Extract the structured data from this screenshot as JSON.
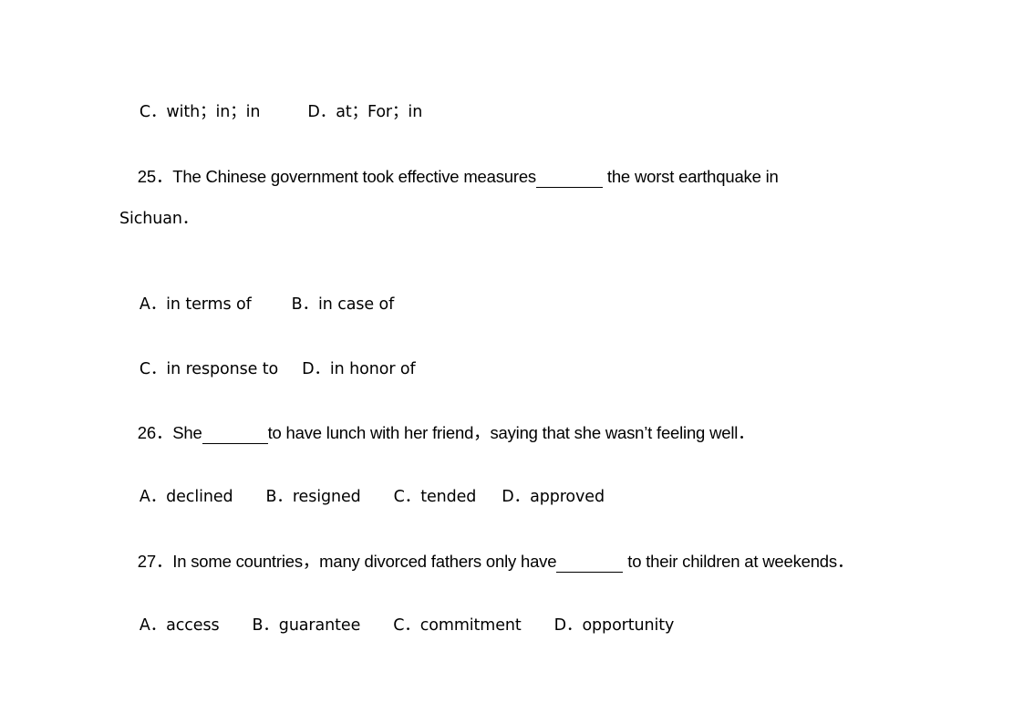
{
  "document": {
    "q24_options_cd": {
      "C": "C．with；in；in",
      "D": "D．at；For；in"
    },
    "q25": {
      "number": "25．",
      "before_blank": "The Chinese government took effective measures",
      "after_blank": " the worst earthquake in",
      "continuation": "Sichuan．",
      "options": {
        "A": "A．in terms of",
        "B": "B．in case of",
        "C": "C．in response to",
        "D": "D．in honor of"
      }
    },
    "q26": {
      "number": "26．",
      "before_blank": "She",
      "after_blank": "to have lunch with her friend，saying that she wasn’t feeling well．",
      "options": {
        "A": "A．declined",
        "B": "B．resigned",
        "C": "C．tended",
        "D": "D．approved"
      }
    },
    "q27": {
      "number": "27．",
      "before_blank": "In some countries，many divorced fathers only have",
      "after_blank": " to their children at weekends．",
      "options": {
        "A": "A．access",
        "B": "B．guarantee",
        "C": "C．commitment",
        "D": "D．opportunity"
      }
    }
  }
}
